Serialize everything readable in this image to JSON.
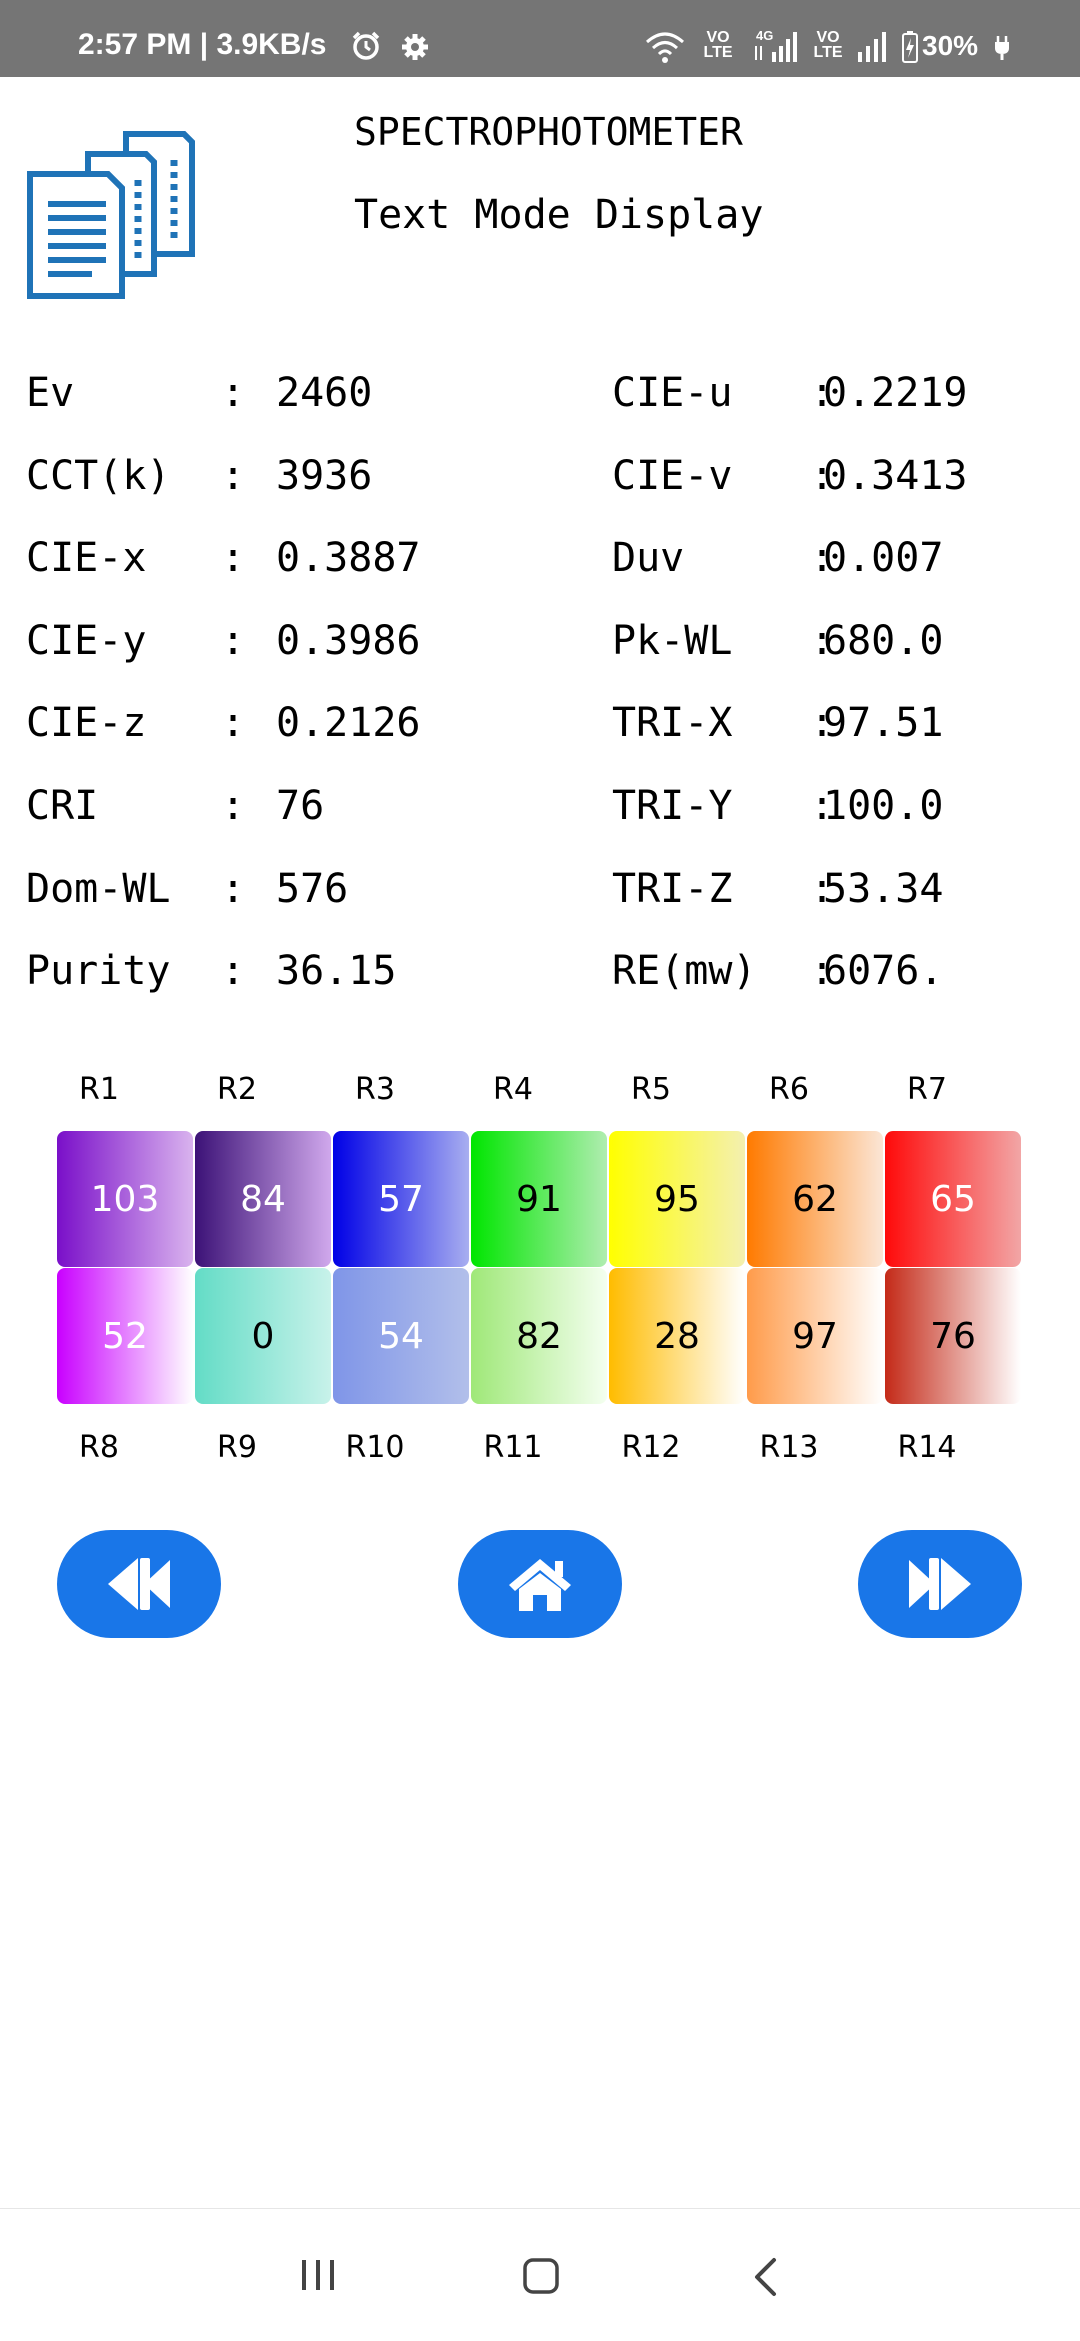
{
  "status_bar": {
    "time_speed": "2:57 PM | 3.9KB/s",
    "volte_1": "VO\nLTE",
    "net_4g": "4G",
    "volte_2": "VO\nLTE",
    "battery": "30%"
  },
  "header": {
    "title": "SPECTROPHOTOMETER",
    "subtitle": "Text Mode Display"
  },
  "metrics_left": [
    {
      "label": "Ev",
      "value": "2460"
    },
    {
      "label": "CCT(k)",
      "value": "3936"
    },
    {
      "label": "CIE-x",
      "value": "0.3887"
    },
    {
      "label": "CIE-y",
      "value": "0.3986"
    },
    {
      "label": "CIE-z",
      "value": "0.2126"
    },
    {
      "label": "CRI",
      "value": "76"
    },
    {
      "label": "Dom-WL",
      "value": "576"
    },
    {
      "label": "Purity",
      "value": "36.15"
    }
  ],
  "metrics_right": [
    {
      "label": "CIE-u",
      "value": "0.2219"
    },
    {
      "label": "CIE-v",
      "value": "0.3413"
    },
    {
      "label": "Duv",
      "value": "0.007"
    },
    {
      "label": "Pk-WL",
      "value": "680.0"
    },
    {
      "label": "TRI-X",
      "value": "97.51"
    },
    {
      "label": "TRI-Y",
      "value": "100.0"
    },
    {
      "label": "TRI-Z",
      "value": "53.34"
    },
    {
      "label": "RE(mw)",
      "value": "6076."
    }
  ],
  "separator": ":",
  "cri_top_labels": [
    "R1",
    "R2",
    "R3",
    "R4",
    "R5",
    "R6",
    "R7"
  ],
  "cri_top_values": [
    "103",
    "84",
    "57",
    "91",
    "95",
    "62",
    "65"
  ],
  "cri_bottom_values": [
    "52",
    "0",
    "54",
    "82",
    "28",
    "97",
    "76"
  ],
  "cri_bottom_labels": [
    "R8",
    "R9",
    "R10",
    "R11",
    "R12",
    "R13",
    "R14"
  ],
  "colors": {
    "accent": "#1976e8",
    "logo_blue": "#1f73b7",
    "status_bar": "#757575"
  },
  "icons": {
    "prev": "rewind-icon",
    "home": "home-icon",
    "next": "fast-forward-icon"
  }
}
